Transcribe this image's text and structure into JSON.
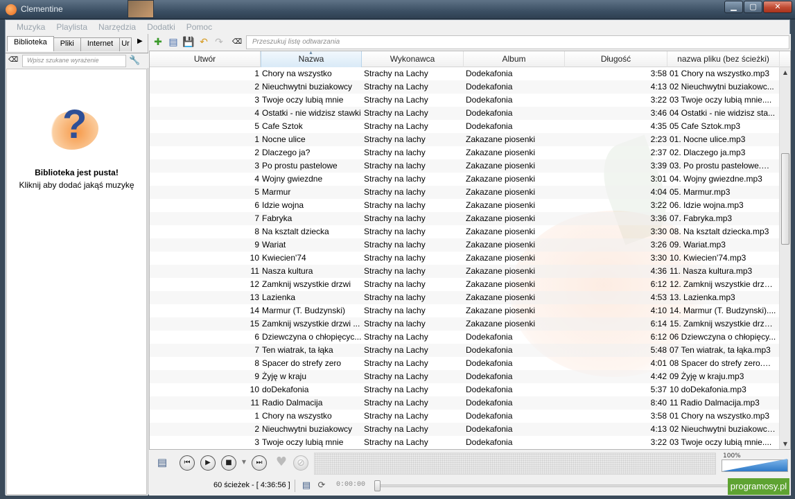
{
  "window": {
    "title": "Clementine",
    "controls": [
      "▁",
      "▢",
      "✕"
    ]
  },
  "menu": [
    "Muzyka",
    "Playlista",
    "Narzędzia",
    "Dodatki",
    "Pomoc"
  ],
  "library": {
    "tabs": [
      "Biblioteka",
      "Pliki",
      "Internet",
      "Ur"
    ],
    "search_placeholder": "Wpisz szukane wyrażenie",
    "empty_title": "Biblioteka jest pusta!",
    "empty_subtitle": "Kliknij aby dodać jakąś muzykę"
  },
  "playlist": {
    "search_placeholder": "Przeszukuj listę odtwarzania",
    "columns": [
      "Utwór",
      "Nazwa",
      "Wykonawca",
      "Album",
      "Długość",
      "nazwa pliku (bez ścieżki)"
    ],
    "sorted_column": "Nazwa",
    "rows": [
      [
        "1",
        "Chory na wszystko",
        "Strachy na Lachy",
        "Dodekafonia",
        "3:58",
        "01 Chory na wszystko.mp3"
      ],
      [
        "2",
        "Nieuchwytni buziakowcy",
        "Strachy na Lachy",
        "Dodekafonia",
        "4:13",
        "02 Nieuchwytni buziakowc..."
      ],
      [
        "3",
        "Twoje oczy lubią mnie",
        "Strachy na Lachy",
        "Dodekafonia",
        "3:22",
        "03 Twoje oczy lubią mnie...."
      ],
      [
        "4",
        "Ostatki - nie widzisz stawki",
        "Strachy na Lachy",
        "Dodekafonia",
        "3:46",
        "04 Ostatki - nie widzisz sta..."
      ],
      [
        "5",
        "Cafe Sztok",
        "Strachy na Lachy",
        "Dodekafonia",
        "4:35",
        "05 Cafe Sztok.mp3"
      ],
      [
        "1",
        "Nocne ulice",
        "Strachy na lachy",
        "Zakazane piosenki",
        "2:23",
        "01. Nocne ulice.mp3"
      ],
      [
        "2",
        "Dlaczego ja?",
        "Strachy na lachy",
        "Zakazane piosenki",
        "2:37",
        "02. Dlaczego ja.mp3"
      ],
      [
        "3",
        "Po prostu pastelowe",
        "Strachy na lachy",
        "Zakazane piosenki",
        "3:39",
        "03. Po prostu pastelowe.mp3"
      ],
      [
        "4",
        "Wojny gwiezdne",
        "Strachy na lachy",
        "Zakazane piosenki",
        "3:01",
        "04. Wojny gwiezdne.mp3"
      ],
      [
        "5",
        "Marmur",
        "Strachy na lachy",
        "Zakazane piosenki",
        "4:04",
        "05. Marmur.mp3"
      ],
      [
        "6",
        "Idzie wojna",
        "Strachy na lachy",
        "Zakazane piosenki",
        "3:22",
        "06. Idzie wojna.mp3"
      ],
      [
        "7",
        "Fabryka",
        "Strachy na lachy",
        "Zakazane piosenki",
        "3:36",
        "07. Fabryka.mp3"
      ],
      [
        "8",
        "Na ksztalt dziecka",
        "Strachy na lachy",
        "Zakazane piosenki",
        "3:30",
        "08. Na ksztalt dziecka.mp3"
      ],
      [
        "9",
        "Wariat",
        "Strachy na lachy",
        "Zakazane piosenki",
        "3:26",
        "09. Wariat.mp3"
      ],
      [
        "10",
        "Kwiecien'74",
        "Strachy na lachy",
        "Zakazane piosenki",
        "3:30",
        "10. Kwiecien'74.mp3"
      ],
      [
        "11",
        "Nasza kultura",
        "Strachy na lachy",
        "Zakazane piosenki",
        "4:36",
        "11. Nasza kultura.mp3"
      ],
      [
        "12",
        "Zamknij wszystkie drzwi",
        "Strachy na lachy",
        "Zakazane piosenki",
        "6:12",
        "12. Zamknij wszystkie drzw..."
      ],
      [
        "13",
        "Lazienka",
        "Strachy na lachy",
        "Zakazane piosenki",
        "4:53",
        "13. Lazienka.mp3"
      ],
      [
        "14",
        "Marmur (T. Budzynski)",
        "Strachy na lachy",
        "Zakazane piosenki",
        "4:10",
        "14. Marmur (T. Budzynski)...."
      ],
      [
        "15",
        "Zamknij wszystkie drzwi ...",
        "Strachy na lachy",
        "Zakazane piosenki",
        "6:14",
        "15. Zamknij wszystkie drzw..."
      ],
      [
        "6",
        "Dziewczyna o chłopięcyc...",
        "Strachy na Lachy",
        "Dodekafonia",
        "6:12",
        "06 Dziewczyna o chłopięcy..."
      ],
      [
        "7",
        "Ten wiatrak, ta łąka",
        "Strachy na Lachy",
        "Dodekafonia",
        "5:48",
        "07 Ten wiatrak, ta łąka.mp3"
      ],
      [
        "8",
        "Spacer do strefy zero",
        "Strachy na Lachy",
        "Dodekafonia",
        "4:01",
        "08 Spacer do strefy zero.mp3"
      ],
      [
        "9",
        "Żyję w kraju",
        "Strachy na Lachy",
        "Dodekafonia",
        "4:42",
        "09 Żyję w kraju.mp3"
      ],
      [
        "10",
        "doDekafonia",
        "Strachy na Lachy",
        "Dodekafonia",
        "5:37",
        "10 doDekafonia.mp3"
      ],
      [
        "11",
        "Radio Dalmacija",
        "Strachy na Lachy",
        "Dodekafonia",
        "8:40",
        "11 Radio Dalmacija.mp3"
      ],
      [
        "1",
        "Chory na wszystko",
        "Strachy na Lachy",
        "Dodekafonia",
        "3:58",
        "01 Chory na wszystko.mp3"
      ],
      [
        "2",
        "Nieuchwytni buziakowcy",
        "Strachy na Lachy",
        "Dodekafonia",
        "4:13",
        "02 Nieuchwytni buziakowcy..."
      ],
      [
        "3",
        "Twoje oczy lubią mnie",
        "Strachy na Lachy",
        "Dodekafonia",
        "3:22",
        "03 Twoje oczy lubią mnie...."
      ]
    ]
  },
  "player": {
    "volume_label": "100%",
    "volume_level": 1.0
  },
  "status": {
    "count": "60 ścieżek - [ 4:36:56 ]",
    "time": "0:00:00"
  },
  "badge": "programosy.pl"
}
